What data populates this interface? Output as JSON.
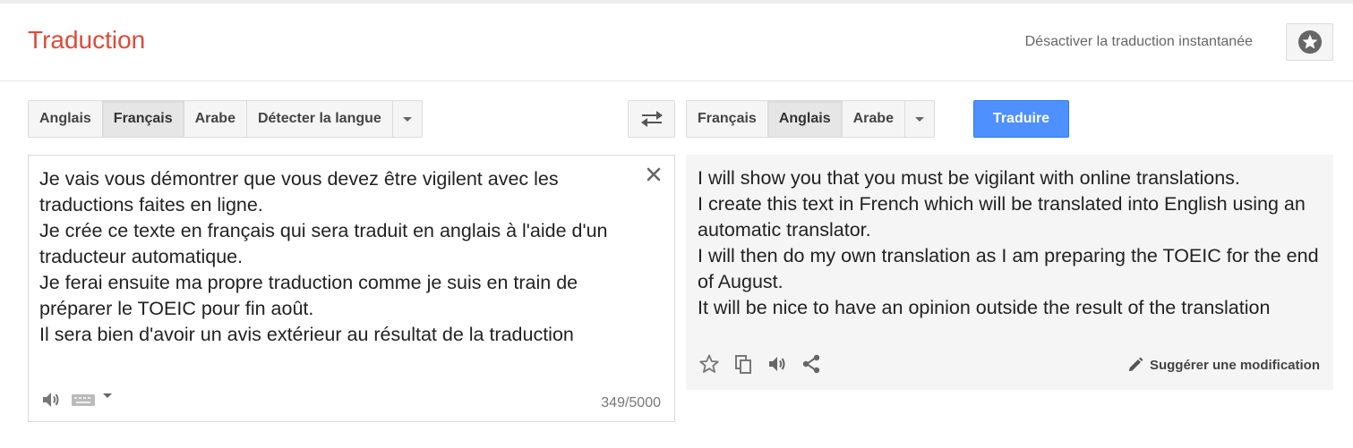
{
  "header": {
    "title": "Traduction",
    "instant_toggle": "Désactiver la traduction instantanée",
    "star_icon": "star-circle-icon"
  },
  "source": {
    "languages": [
      "Anglais",
      "Français",
      "Arabe",
      "Détecter la langue"
    ],
    "active_language": "Français",
    "text": "Je vais vous démontrer que vous devez être vigilent avec les traductions faites en ligne.\nJe crée ce texte en français qui sera traduit en anglais à l'aide d'un traducteur automatique.\nJe ferai ensuite ma propre traduction comme je suis en train de préparer le TOEIC pour fin août.\nIl sera bien d'avoir un avis extérieur au résultat de la traduction",
    "char_count": "349/5000"
  },
  "target": {
    "languages": [
      "Français",
      "Anglais",
      "Arabe"
    ],
    "active_language": "Anglais",
    "translate_label": "Traduire",
    "text": "I will show you that you must be vigilant with online translations.\nI create this text in French which will be translated into English using an automatic translator.\nI will then do my own translation as I am preparing the TOEIC for the end of August.\nIt will be nice to have an opinion outside the result of the translation",
    "suggest_label": "Suggérer une modification"
  },
  "colors": {
    "brand": "#dd4b39",
    "primary_button": "#4d90fe",
    "panel_bg": "#f5f5f5"
  }
}
